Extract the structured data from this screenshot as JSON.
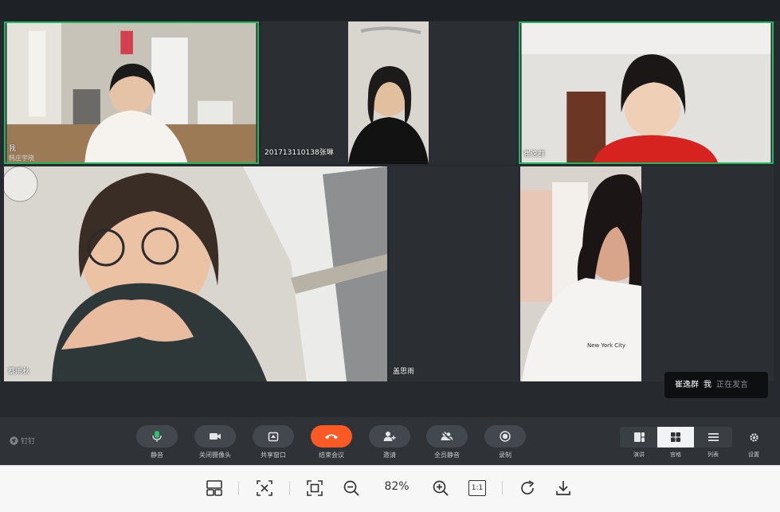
{
  "tiles": [
    {
      "name": "我",
      "sub": "韩庄宇晓"
    },
    {
      "name": "201713110138张琳",
      "sub": ""
    },
    {
      "name": "崔逸群",
      "sub": ""
    },
    {
      "name": "蔡雨秋",
      "sub": ""
    },
    {
      "name": "盖思雨",
      "sub": ""
    },
    {
      "name": "",
      "sub": ""
    }
  ],
  "shirt_text": "New York City",
  "speaking": {
    "who": "崔逸群",
    "me": "我",
    "status": "正在发言"
  },
  "brand": "钉钉",
  "controls": [
    {
      "label": "静音",
      "icon": "mic-icon"
    },
    {
      "label": "关闭摄像头",
      "icon": "camera-icon"
    },
    {
      "label": "共享窗口",
      "icon": "share-screen-icon"
    },
    {
      "label": "结束会议",
      "icon": "hangup-icon"
    },
    {
      "label": "邀请",
      "icon": "add-person-icon"
    },
    {
      "label": "全员静音",
      "icon": "mute-all-icon"
    },
    {
      "label": "录制",
      "icon": "record-icon"
    }
  ],
  "views": [
    {
      "label": "演讲",
      "icon": "speaker-view-icon"
    },
    {
      "label": "宫格",
      "icon": "grid-view-icon"
    },
    {
      "label": "列表",
      "icon": "list-view-icon"
    }
  ],
  "settings_label": "设置",
  "viewer": {
    "zoom": "82%",
    "actual_size": "1:1"
  },
  "colors": {
    "active_border": "#1fb85c",
    "end_call": "#fb5a26",
    "background": "#262a2e"
  }
}
